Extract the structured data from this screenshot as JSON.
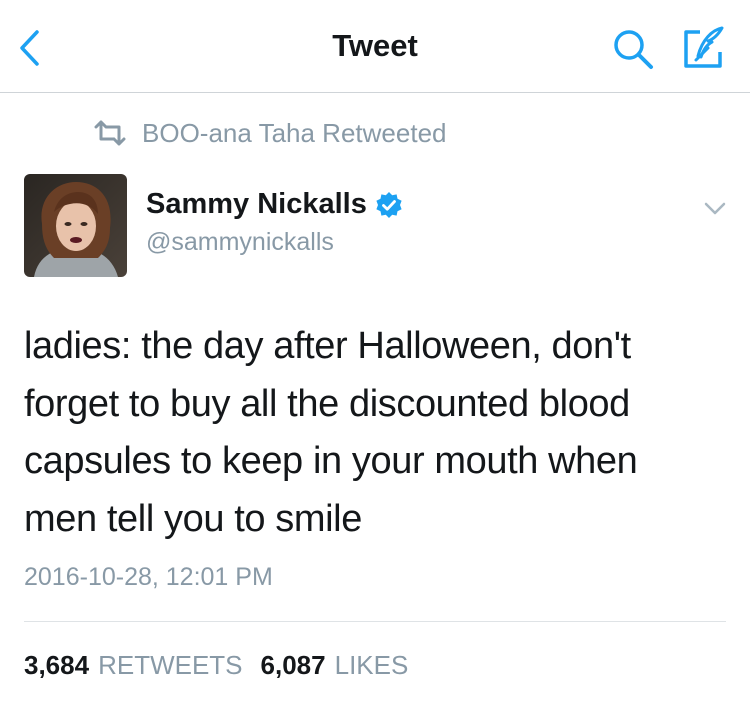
{
  "navbar": {
    "title": "Tweet",
    "accent_color": "#1da1f2",
    "back_icon": "chevron-left-icon",
    "search_icon": "search-icon",
    "compose_icon": "compose-icon"
  },
  "retweeted_by": {
    "icon": "retweet-icon",
    "text": "BOO-ana Taha Retweeted"
  },
  "tweet": {
    "author": {
      "name": "Sammy Nickalls",
      "handle": "@sammynickalls",
      "verified": true
    },
    "text_lines": [
      "ladies: the day after Halloween, don't",
      "forget to buy all the discounted blood",
      "capsules to keep in your mouth when",
      "men tell you to smile"
    ],
    "timestamp": "2016-10-28, 12:01 PM",
    "stats": {
      "retweets_count": "3,684",
      "retweets_label": "RETWEETS",
      "likes_count": "6,087",
      "likes_label": "LIKES"
    }
  },
  "colors": {
    "text_primary": "#14171a",
    "text_secondary": "#8899a6",
    "verified_blue": "#1da1f2",
    "divider": "#cfd4d8"
  }
}
